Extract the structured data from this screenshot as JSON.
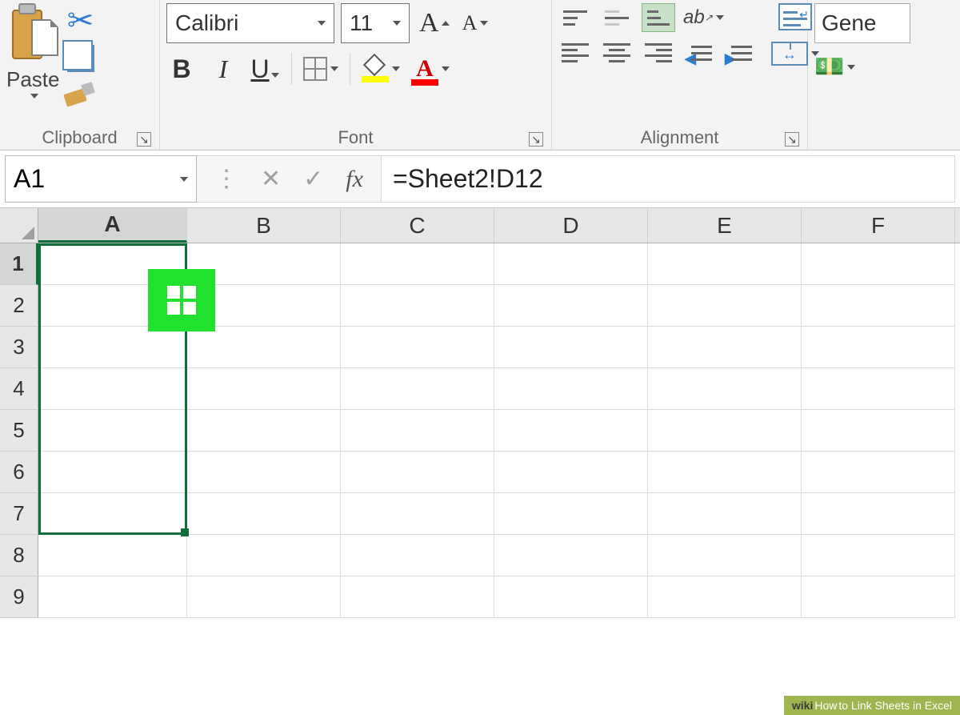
{
  "ribbon": {
    "clipboard": {
      "paste_label": "Paste",
      "group_label": "Clipboard"
    },
    "font": {
      "name": "Calibri",
      "size": "11",
      "bold": "B",
      "italic": "I",
      "underline": "U",
      "group_label": "Font"
    },
    "alignment": {
      "orientation_glyph": "ab",
      "group_label": "Alignment"
    },
    "number": {
      "format": "Gene",
      "currency_glyph": "$"
    }
  },
  "formula_bar": {
    "name_box": "A1",
    "fx_label": "fx",
    "formula": "=Sheet2!D12"
  },
  "grid": {
    "columns": [
      "A",
      "B",
      "C",
      "D",
      "E",
      "F"
    ],
    "rows": [
      "1",
      "2",
      "3",
      "4",
      "5",
      "6",
      "7",
      "8",
      "9"
    ],
    "selected_column": "A",
    "selected_row": "1",
    "selection": "A1:A7"
  },
  "watermark": {
    "brand": "wiki",
    "brand2": "How",
    "title": " to Link Sheets in Excel"
  }
}
